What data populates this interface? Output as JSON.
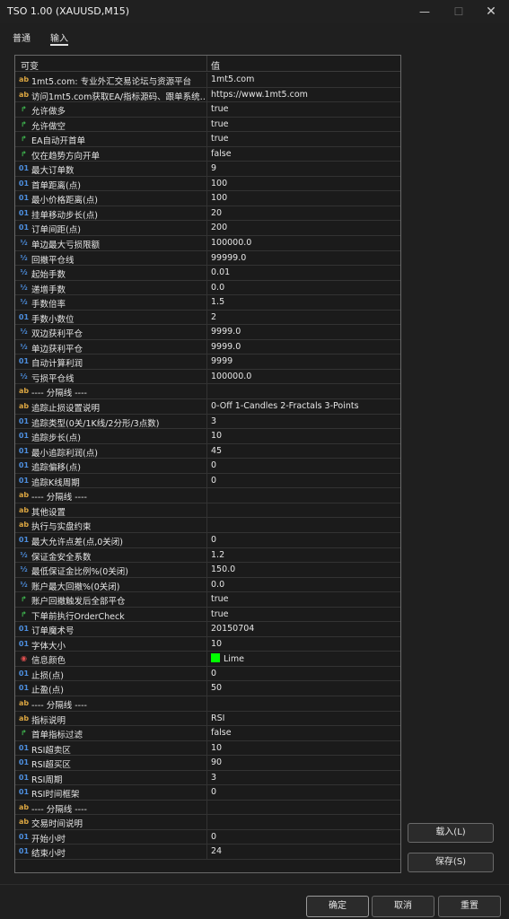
{
  "window": {
    "title": "TSO 1.00 (XAUUSD,M15)",
    "min_glyph": "—",
    "max_glyph": "☐",
    "close_glyph": "✕"
  },
  "tabs": [
    {
      "label": "普通"
    },
    {
      "label": "输入"
    }
  ],
  "grid": {
    "col_variable": "可变",
    "col_value": "值",
    "rows": [
      {
        "t": "ab",
        "name": "1mt5.com: 专业外汇交易论坛与资源平台",
        "value": "1mt5.com"
      },
      {
        "t": "ab",
        "name": "访问1mt5.com获取EA/指标源码、跟单系统…",
        "value": "https://www.1mt5.com"
      },
      {
        "t": "bool",
        "name": "允许做多",
        "value": "true"
      },
      {
        "t": "bool",
        "name": "允许做空",
        "value": "true"
      },
      {
        "t": "bool",
        "name": "EA自动开首单",
        "value": "true"
      },
      {
        "t": "bool",
        "name": "仅在趋势方向开单",
        "value": "false"
      },
      {
        "t": "int",
        "name": "最大订单数",
        "value": "9"
      },
      {
        "t": "int",
        "name": "首单距离(点)",
        "value": "100"
      },
      {
        "t": "int",
        "name": "最小价格距离(点)",
        "value": "100"
      },
      {
        "t": "int",
        "name": "挂单移动步长(点)",
        "value": "20"
      },
      {
        "t": "int",
        "name": "订单间距(点)",
        "value": "200"
      },
      {
        "t": "dbl",
        "name": "单边最大亏损限额",
        "value": "100000.0"
      },
      {
        "t": "dbl",
        "name": "回撤平仓线",
        "value": "99999.0"
      },
      {
        "t": "dbl",
        "name": "起始手数",
        "value": "0.01"
      },
      {
        "t": "dbl",
        "name": "递增手数",
        "value": "0.0"
      },
      {
        "t": "dbl",
        "name": "手数倍率",
        "value": "1.5"
      },
      {
        "t": "int",
        "name": "手数小数位",
        "value": "2"
      },
      {
        "t": "dbl",
        "name": "双边获利平仓",
        "value": "9999.0"
      },
      {
        "t": "dbl",
        "name": "单边获利平仓",
        "value": "9999.0"
      },
      {
        "t": "int",
        "name": "自动计算利润",
        "value": "9999"
      },
      {
        "t": "dbl",
        "name": "亏损平仓线",
        "value": "100000.0"
      },
      {
        "t": "ab",
        "name": "---- 分隔线 ----",
        "value": ""
      },
      {
        "t": "ab",
        "name": "追踪止损设置说明",
        "value": "0-Off  1-Candles  2-Fractals  3-Points"
      },
      {
        "t": "int",
        "name": "追踪类型(0关/1K线/2分形/3点数)",
        "value": "3"
      },
      {
        "t": "int",
        "name": "追踪步长(点)",
        "value": "10"
      },
      {
        "t": "int",
        "name": "最小追踪利润(点)",
        "value": "45"
      },
      {
        "t": "int",
        "name": "追踪偏移(点)",
        "value": "0"
      },
      {
        "t": "int",
        "name": "追踪K线周期",
        "value": "0"
      },
      {
        "t": "ab",
        "name": "---- 分隔线 ----",
        "value": ""
      },
      {
        "t": "ab",
        "name": "其他设置",
        "value": ""
      },
      {
        "t": "ab",
        "name": "执行与实盘约束",
        "value": ""
      },
      {
        "t": "int",
        "name": "最大允许点差(点,0关闭)",
        "value": "0"
      },
      {
        "t": "dbl",
        "name": "保证金安全系数",
        "value": "1.2"
      },
      {
        "t": "dbl",
        "name": "最低保证金比例%(0关闭)",
        "value": "150.0"
      },
      {
        "t": "dbl",
        "name": "账户最大回撤%(0关闭)",
        "value": "0.0"
      },
      {
        "t": "bool",
        "name": "账户回撤触发后全部平仓",
        "value": "true"
      },
      {
        "t": "bool",
        "name": "下单前执行OrderCheck",
        "value": "true"
      },
      {
        "t": "int",
        "name": "订单魔术号",
        "value": "20150704"
      },
      {
        "t": "int",
        "name": "字体大小",
        "value": "10"
      },
      {
        "t": "color",
        "name": "信息颜色",
        "value": "Lime",
        "swatch": "#00ff00"
      },
      {
        "t": "int",
        "name": "止损(点)",
        "value": "0"
      },
      {
        "t": "int",
        "name": "止盈(点)",
        "value": "50"
      },
      {
        "t": "ab",
        "name": "---- 分隔线 ----",
        "value": ""
      },
      {
        "t": "ab",
        "name": "指标说明",
        "value": "RSI"
      },
      {
        "t": "bool",
        "name": "首单指标过滤",
        "value": "false"
      },
      {
        "t": "int",
        "name": "RSI超卖区",
        "value": "10"
      },
      {
        "t": "int",
        "name": "RSI超买区",
        "value": "90"
      },
      {
        "t": "int",
        "name": "RSI周期",
        "value": "3"
      },
      {
        "t": "int",
        "name": "RSI时间框架",
        "value": "0"
      },
      {
        "t": "ab",
        "name": "---- 分隔线 ----",
        "value": ""
      },
      {
        "t": "ab",
        "name": "交易时间说明",
        "value": ""
      },
      {
        "t": "int",
        "name": "开始小时",
        "value": "0"
      },
      {
        "t": "int",
        "name": "结束小时",
        "value": "24"
      }
    ]
  },
  "type_icons": {
    "ab": "ab",
    "int": "01",
    "dbl": "½",
    "bool": "↱",
    "color": "◉"
  },
  "side_buttons": {
    "load": "载入(L)",
    "save": "保存(S)"
  },
  "footer": {
    "ok": "确定",
    "cancel": "取消",
    "reset": "重置"
  }
}
